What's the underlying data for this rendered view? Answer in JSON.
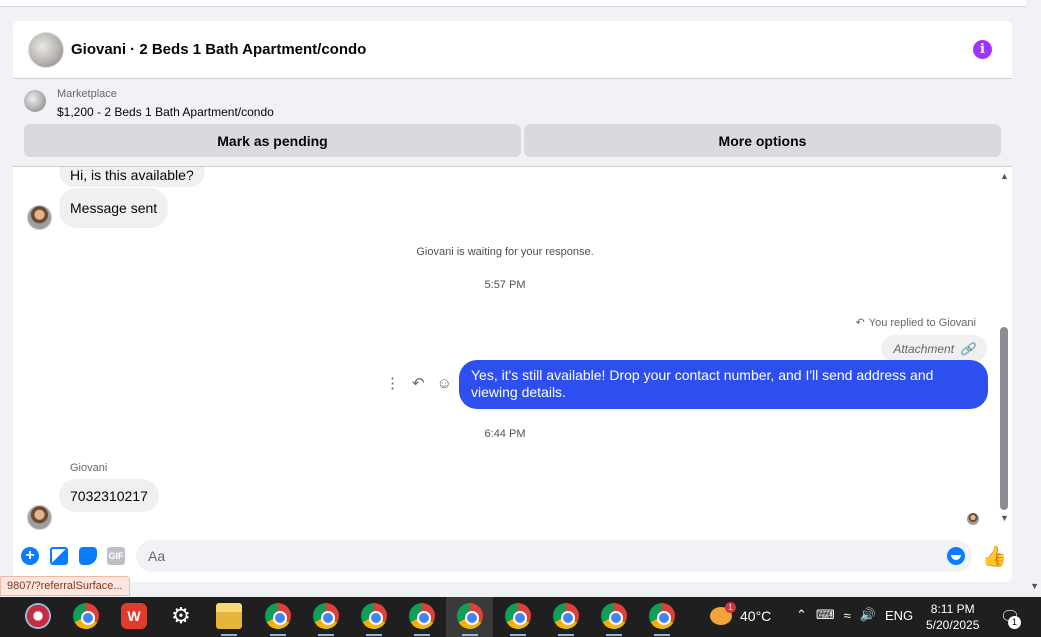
{
  "header": {
    "title": "Giovani · 2 Beds 1 Bath Apartment/condo",
    "info_icon": "info-icon",
    "accent": "#a033ff"
  },
  "listing": {
    "kind": "Marketplace",
    "price_line": "$1,200 - 2 Beds 1 Bath Apartment/condo",
    "mark_pending": "Mark as pending",
    "more_options": "More options"
  },
  "messages": {
    "first_message": "Hi, is this available?",
    "message_sent": "Message sent",
    "waiting_notice": "Giovani is waiting for your response.",
    "time_1": "5:57 PM",
    "replied_label": "You replied to Giovani",
    "attachment_label": "Attachment",
    "reply_text": "Yes, it's still available! Drop your contact number, and I'll send address and viewing details.",
    "time_2": "6:44 PM",
    "sender_name": "Giovani",
    "last_message": "7032310217",
    "outgoing_color": "#2d4ff0"
  },
  "composer": {
    "placeholder": "Aa",
    "gif_label": "GIF"
  },
  "status_url": "9807/?referralSurface...",
  "taskbar": {
    "weather": "40°C",
    "weather_badge": "1",
    "lang": "ENG",
    "time": "8:11 PM",
    "date": "5/20/2025",
    "notif_count": "1",
    "wps_label": "W"
  }
}
